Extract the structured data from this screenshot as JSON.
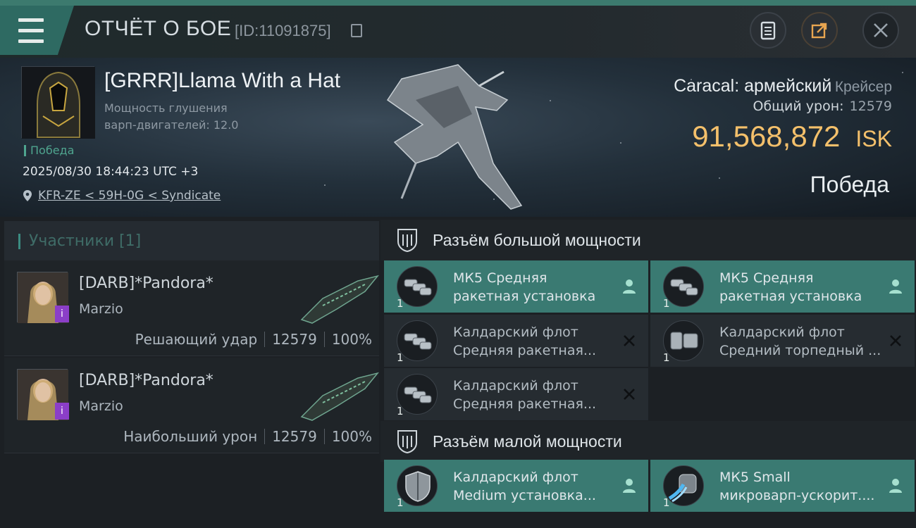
{
  "header": {
    "title": "ОТЧЁТ О БОЕ",
    "report_id": "[ID:11091875]",
    "icons": [
      "menu-icon",
      "clipboard-icon",
      "share-icon",
      "close-icon"
    ]
  },
  "victim": {
    "name": "[GRRR]Llama With a Hat",
    "stat_label_1": "Мощность глушения",
    "stat_label_2": "варп-двигателей: 12.0",
    "result": "Победа",
    "datetime": "2025/08/30 18:44:23 UTC +3",
    "location": "KFR-ZE < 59H-0G < Syndicate",
    "ship_name": "Caracal: армейский",
    "ship_type": "Крейсер",
    "damage_label": "Общий урон:",
    "damage_value": "12579",
    "isk_value": "91,568,872",
    "isk_currency": "ISK",
    "outcome": "Победа"
  },
  "participants": {
    "header": "Участники [1]",
    "items": [
      {
        "name": "[DARB]*Pandora*",
        "ship": "Marzio",
        "role": "Решающий удар",
        "damage": "12579",
        "percent": "100%",
        "badge": "i"
      },
      {
        "name": "[DARB]*Pandora*",
        "ship": "Marzio",
        "role": "Наибольший урон",
        "damage": "12579",
        "percent": "100%",
        "badge": "i"
      }
    ]
  },
  "slots": {
    "high_title": "Разъём большой мощности",
    "low_title": "Разъём малой мощности",
    "high": [
      {
        "l1": "МК5 Средняя",
        "l2": "ракетная установка",
        "qty": "1",
        "state": "dropped"
      },
      {
        "l1": "МК5 Средняя",
        "l2": "ракетная установка",
        "qty": "1",
        "state": "dropped"
      },
      {
        "l1": "Калдарский флот",
        "l2": "Средняя ракетная...",
        "qty": "1",
        "state": "destroyed"
      },
      {
        "l1": "Калдарский флот",
        "l2": "Средний торпедный ...",
        "qty": "1",
        "state": "destroyed"
      },
      {
        "l1": "Калдарский флот",
        "l2": "Средняя ракетная...",
        "qty": "1",
        "state": "destroyed"
      }
    ],
    "low": [
      {
        "l1": "Калдарский флот",
        "l2": "Medium установка...",
        "qty": "1",
        "state": "dropped"
      },
      {
        "l1": "МК5 Small",
        "l2": "микроварп-ускорит....",
        "qty": "1",
        "state": "dropped"
      }
    ]
  },
  "colors": {
    "accent": "#3a7a72",
    "isk": "#f4c06b",
    "victory": "#4fa58f",
    "badge": "#8b3ec8"
  }
}
